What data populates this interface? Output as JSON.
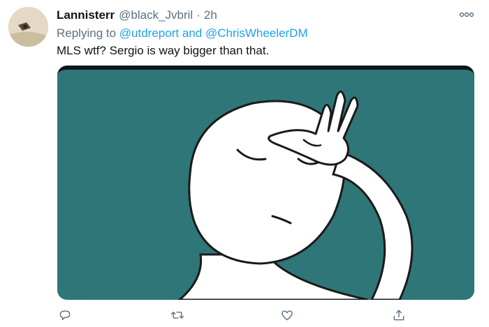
{
  "tweet": {
    "author_name": "Lannisterr",
    "author_handle": "@black_Jvbril",
    "separator": "·",
    "time": "2h",
    "replying_prefix": "Replying to",
    "replying_to": [
      "@utdreport",
      "@ChrisWheelerDM"
    ],
    "replying_joiner": "and",
    "text": "MLS wtf? Sergio is way bigger than that.",
    "media": {
      "type": "image",
      "background_color": "#2f7678"
    }
  },
  "icons": {
    "more": "more-options-icon",
    "reply": "reply-icon",
    "retweet": "retweet-icon",
    "like": "heart-icon",
    "share": "share-icon"
  },
  "colors": {
    "link": "#1da1f2",
    "secondary": "#5b7083",
    "primary_text": "#0f1419"
  }
}
